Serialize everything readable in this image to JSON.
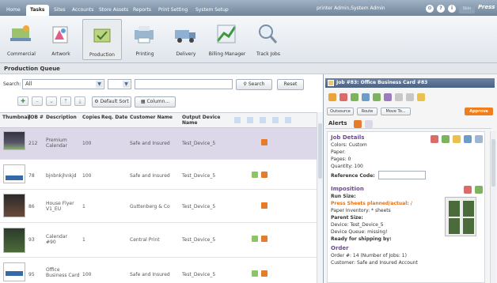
{
  "nav": {
    "tabs": [
      "Home",
      "Tasks",
      "Sites",
      "Accounts",
      "Store Assets",
      "Reports",
      "Print Setting",
      "System Setup"
    ],
    "active": 1,
    "user": "printer Admin,System Admin",
    "help": "?",
    "skin": "Skin",
    "logo": "Press"
  },
  "toolbar": {
    "items": [
      "Commercial",
      "Artwork",
      "Production",
      "Printing",
      "Delivery",
      "Billing Manager",
      "Track Jobs"
    ],
    "active": 2
  },
  "breadcrumb": "Production Queue",
  "search": {
    "label": "Search:",
    "scope": "All",
    "value": "",
    "search_btn": "Search",
    "reset_btn": "Reset",
    "default_sort": "Default Sort",
    "columns": "Column..."
  },
  "grid": {
    "headers": [
      "Thumbnail",
      "JOB #",
      "Description",
      "Copies",
      "Req. Date",
      "Customer Name",
      "Output Device Name"
    ],
    "rows": [
      {
        "job": "212",
        "desc": "Premium\nCalendar",
        "copies": "100",
        "date": "",
        "customer": "Safe and Insured",
        "device": "Test_Device_5"
      },
      {
        "job": "78",
        "desc": "bjnbnkjhnkjd",
        "copies": "100",
        "date": "",
        "customer": "Safe and Insured",
        "device": "Test_Device_5"
      },
      {
        "job": "86",
        "desc": "House Flyer\nV1_EU",
        "copies": "1",
        "date": "",
        "customer": "Guttenberg & Co",
        "device": "Test_Device_5"
      },
      {
        "job": "93",
        "desc": "Calendar\n#90",
        "copies": "1",
        "date": "",
        "customer": "Central Print",
        "device": "Test_Device_5"
      },
      {
        "job": "95",
        "desc": "Office\nBusiness Card",
        "copies": "100",
        "date": "",
        "customer": "Safe and Insured",
        "device": "Test_Device_5"
      }
    ]
  },
  "job": {
    "title": "Job #83: Office Business Card #83",
    "outsource": "Outsource",
    "route": "Route",
    "move": "Move To...",
    "approve": "Approve",
    "alerts": "Alerts",
    "details_title": "Job Details",
    "colors": "Colors: Custom",
    "paper": "Paper:",
    "pages": "Pages: 0",
    "quantity": "Quantity: 100",
    "reference": "Reference Code:",
    "imposition_title": "Imposition",
    "run_size": "Run Size:",
    "press_sheets": "Press Sheets planned/actual: /",
    "paper_inventory": "Paper Inventory: * sheets",
    "parent_size": "Parent Size:",
    "device": "Device: Test_Device_5",
    "device_queue": "Device Queue: missing!",
    "ready": "Ready for shipping by:",
    "order_title": "Order",
    "order_line": "Order #: 14 (Number of Jobs: 1)",
    "customer_line": "Customer: Safe and Insured Account"
  }
}
